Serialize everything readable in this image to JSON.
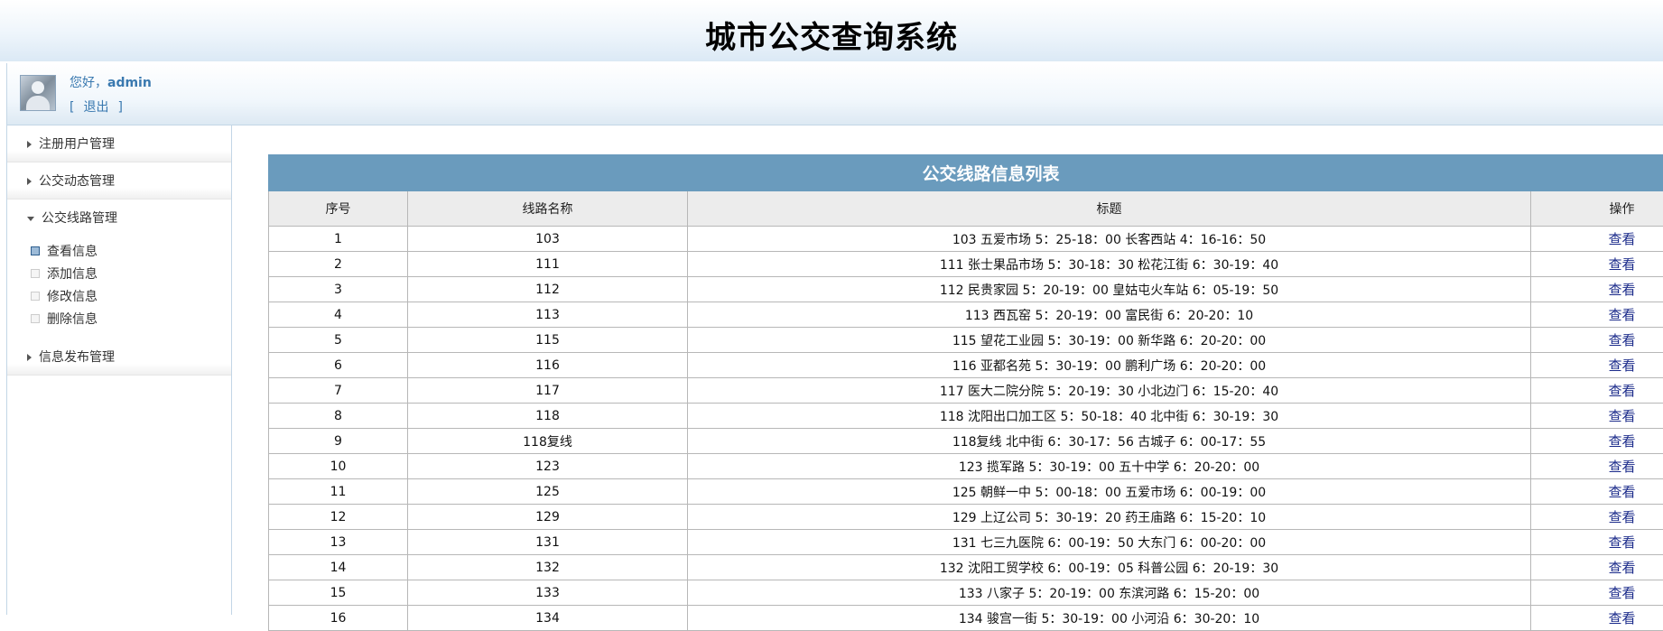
{
  "header": {
    "title": "城市公交查询系统"
  },
  "user": {
    "greeting": "您好，",
    "name": "admin",
    "logout_open": "[",
    "logout": "退出",
    "logout_close": "]"
  },
  "sidebar": {
    "menus": [
      {
        "label": "注册用户管理"
      },
      {
        "label": "公交动态管理"
      },
      {
        "label": "公交线路管理"
      },
      {
        "label": "信息发布管理"
      }
    ],
    "submenu": [
      {
        "label": "查看信息"
      },
      {
        "label": "添加信息"
      },
      {
        "label": "修改信息"
      },
      {
        "label": "删除信息"
      }
    ]
  },
  "table": {
    "caption": "公交线路信息列表",
    "headers": [
      "序号",
      "线路名称",
      "标题",
      "操作"
    ],
    "rows": [
      {
        "no": "1",
        "name": "103",
        "title": "103 五爱市场 5：25-18：00 长客西站 4：16-16：50",
        "op": "查看"
      },
      {
        "no": "2",
        "name": "111",
        "title": "111 张士果品市场 5：30-18：30 松花江街 6：30-19：40",
        "op": "查看"
      },
      {
        "no": "3",
        "name": "112",
        "title": "112 民贵家园 5：20-19：00 皇姑屯火车站 6：05-19：50",
        "op": "查看"
      },
      {
        "no": "4",
        "name": "113",
        "title": "113 西瓦窑 5：20-19：00 富民街 6：20-20：10",
        "op": "查看"
      },
      {
        "no": "5",
        "name": "115",
        "title": "115 望花工业园 5：30-19：00 新华路 6：20-20：00",
        "op": "查看"
      },
      {
        "no": "6",
        "name": "116",
        "title": "116 亚都名苑 5：30-19：00 鹏利广场 6：20-20：00",
        "op": "查看"
      },
      {
        "no": "7",
        "name": "117",
        "title": "117 医大二院分院 5：20-19：30 小北边门 6：15-20：40",
        "op": "查看"
      },
      {
        "no": "8",
        "name": "118",
        "title": "118 沈阳出口加工区 5：50-18：40 北中街 6：30-19：30",
        "op": "查看"
      },
      {
        "no": "9",
        "name": "118复线",
        "title": "118复线 北中街 6：30-17：56 古城子 6：00-17：55",
        "op": "查看"
      },
      {
        "no": "10",
        "name": "123",
        "title": "123 揽军路 5：30-19：00 五十中学 6：20-20：00",
        "op": "查看"
      },
      {
        "no": "11",
        "name": "125",
        "title": "125 朝鲜一中 5：00-18：00 五爱市场 6：00-19：00",
        "op": "查看"
      },
      {
        "no": "12",
        "name": "129",
        "title": "129 上辽公司 5：30-19：20 药王庙路 6：15-20：10",
        "op": "查看"
      },
      {
        "no": "13",
        "name": "131",
        "title": "131 七三九医院 6：00-19：50 大东门 6：00-20：00",
        "op": "查看"
      },
      {
        "no": "14",
        "name": "132",
        "title": "132 沈阳工贸学校 6：00-19：05 科普公园 6：20-19：30",
        "op": "查看"
      },
      {
        "no": "15",
        "name": "133",
        "title": "133 八家子 5：20-19：00 东滨河路 6：15-20：00",
        "op": "查看"
      },
      {
        "no": "16",
        "name": "134",
        "title": "134 骏宫一街 5：30-19：00 小河沿 6：30-20：10",
        "op": "查看"
      }
    ]
  }
}
